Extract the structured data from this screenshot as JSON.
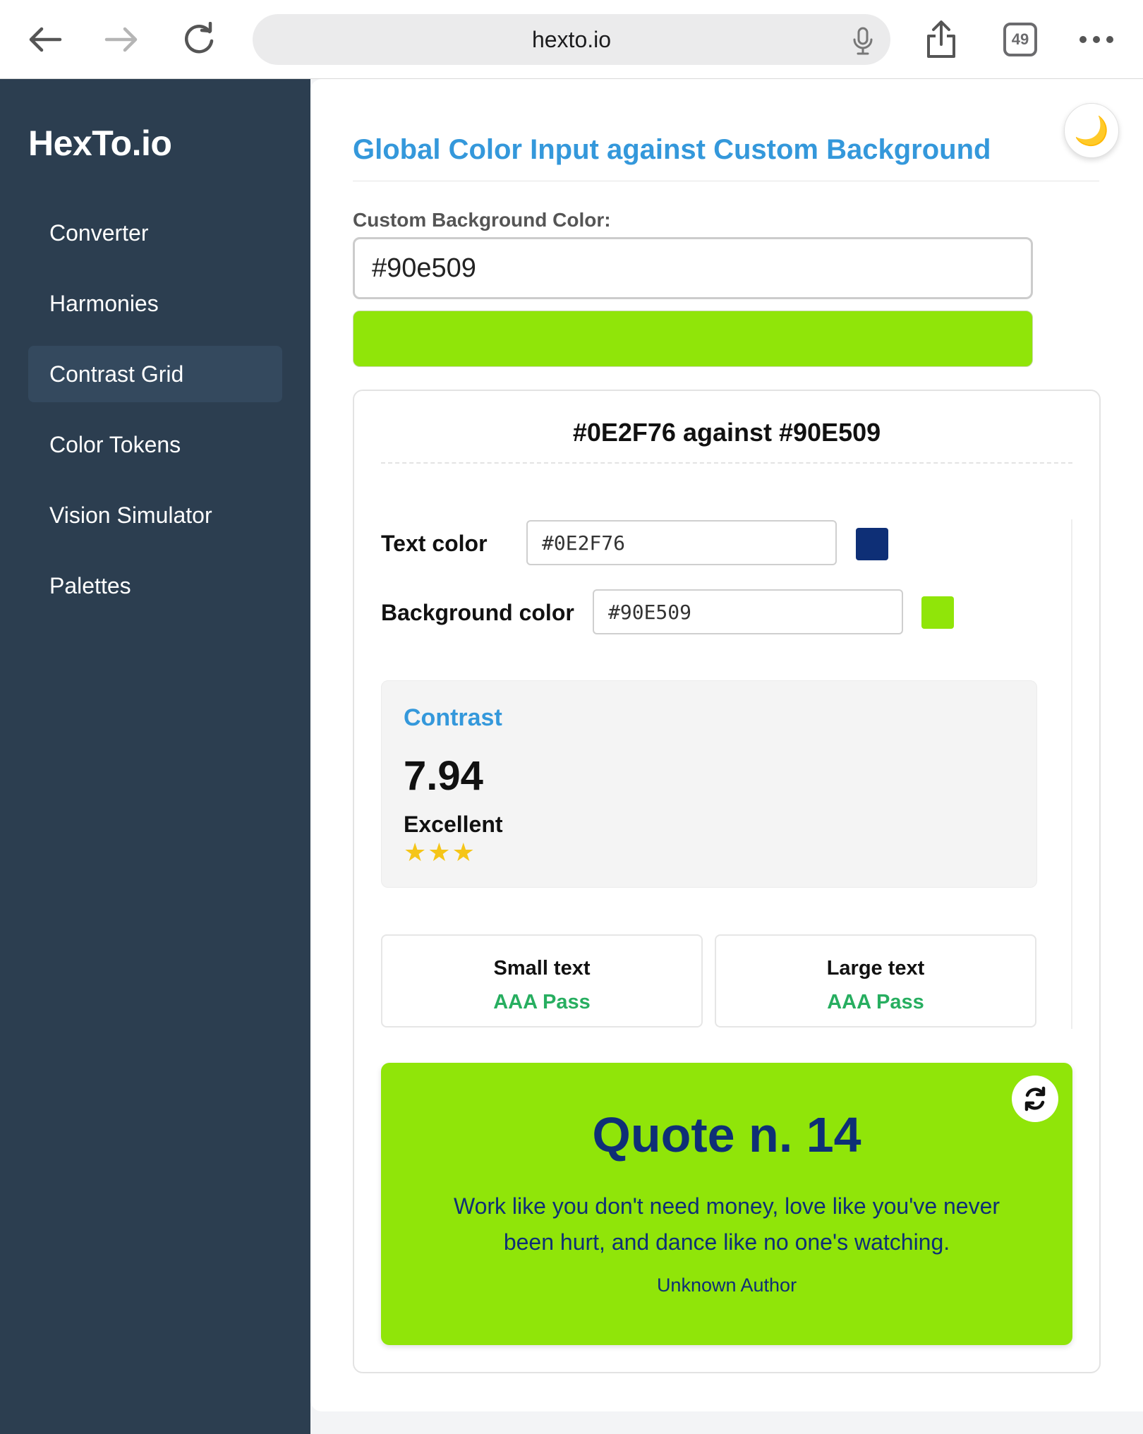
{
  "browser": {
    "url": "hexto.io",
    "tab_count": "49"
  },
  "sidebar": {
    "logo": "HexTo.io",
    "items": [
      {
        "label": "Converter"
      },
      {
        "label": "Harmonies"
      },
      {
        "label": "Contrast Grid",
        "active": true
      },
      {
        "label": "Color Tokens"
      },
      {
        "label": "Vision Simulator"
      },
      {
        "label": "Palettes"
      }
    ]
  },
  "header": {
    "title": "Global Color Input against Custom Background",
    "theme_icon": "moon-icon"
  },
  "custom_bg": {
    "label": "Custom Background Color:",
    "value": "#90e509"
  },
  "contrast": {
    "title": "#0E2F76 against #90E509",
    "text_color_label": "Text color",
    "text_color_value": "#0E2F76",
    "bg_color_label": "Background color",
    "bg_color_value": "#90E509",
    "score_heading": "Contrast",
    "ratio": "7.94",
    "rating": "Excellent",
    "stars": 3,
    "small_text_label": "Small text",
    "small_text_result": "AAA Pass",
    "large_text_label": "Large text",
    "large_text_result": "AAA Pass"
  },
  "quote": {
    "title": "Quote n. 14",
    "text": "Work like you don't need money, love like you've never been hurt, and dance like no one's watching.",
    "author": "Unknown Author",
    "refresh_icon": "refresh-icon"
  },
  "colors": {
    "text": "#0E2F76",
    "background": "#90E509",
    "accent": "#3498db",
    "sidebar": "#2c3e50",
    "pass": "#27ae60"
  }
}
